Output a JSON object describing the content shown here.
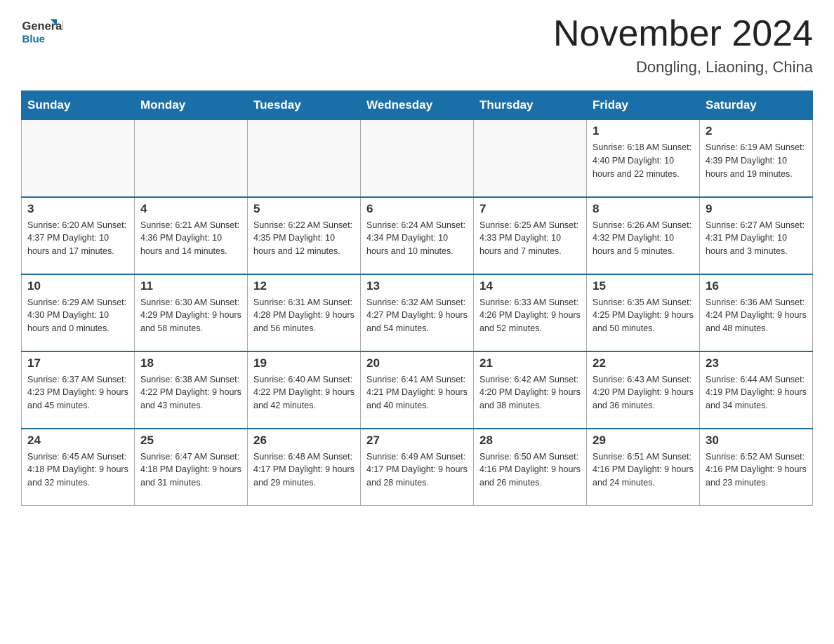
{
  "header": {
    "logo_general": "General",
    "logo_blue": "Blue",
    "month_title": "November 2024",
    "location": "Dongling, Liaoning, China"
  },
  "days_of_week": [
    "Sunday",
    "Monday",
    "Tuesday",
    "Wednesday",
    "Thursday",
    "Friday",
    "Saturday"
  ],
  "weeks": [
    {
      "days": [
        {
          "number": "",
          "info": ""
        },
        {
          "number": "",
          "info": ""
        },
        {
          "number": "",
          "info": ""
        },
        {
          "number": "",
          "info": ""
        },
        {
          "number": "",
          "info": ""
        },
        {
          "number": "1",
          "info": "Sunrise: 6:18 AM\nSunset: 4:40 PM\nDaylight: 10 hours\nand 22 minutes."
        },
        {
          "number": "2",
          "info": "Sunrise: 6:19 AM\nSunset: 4:39 PM\nDaylight: 10 hours\nand 19 minutes."
        }
      ]
    },
    {
      "days": [
        {
          "number": "3",
          "info": "Sunrise: 6:20 AM\nSunset: 4:37 PM\nDaylight: 10 hours\nand 17 minutes."
        },
        {
          "number": "4",
          "info": "Sunrise: 6:21 AM\nSunset: 4:36 PM\nDaylight: 10 hours\nand 14 minutes."
        },
        {
          "number": "5",
          "info": "Sunrise: 6:22 AM\nSunset: 4:35 PM\nDaylight: 10 hours\nand 12 minutes."
        },
        {
          "number": "6",
          "info": "Sunrise: 6:24 AM\nSunset: 4:34 PM\nDaylight: 10 hours\nand 10 minutes."
        },
        {
          "number": "7",
          "info": "Sunrise: 6:25 AM\nSunset: 4:33 PM\nDaylight: 10 hours\nand 7 minutes."
        },
        {
          "number": "8",
          "info": "Sunrise: 6:26 AM\nSunset: 4:32 PM\nDaylight: 10 hours\nand 5 minutes."
        },
        {
          "number": "9",
          "info": "Sunrise: 6:27 AM\nSunset: 4:31 PM\nDaylight: 10 hours\nand 3 minutes."
        }
      ]
    },
    {
      "days": [
        {
          "number": "10",
          "info": "Sunrise: 6:29 AM\nSunset: 4:30 PM\nDaylight: 10 hours\nand 0 minutes."
        },
        {
          "number": "11",
          "info": "Sunrise: 6:30 AM\nSunset: 4:29 PM\nDaylight: 9 hours\nand 58 minutes."
        },
        {
          "number": "12",
          "info": "Sunrise: 6:31 AM\nSunset: 4:28 PM\nDaylight: 9 hours\nand 56 minutes."
        },
        {
          "number": "13",
          "info": "Sunrise: 6:32 AM\nSunset: 4:27 PM\nDaylight: 9 hours\nand 54 minutes."
        },
        {
          "number": "14",
          "info": "Sunrise: 6:33 AM\nSunset: 4:26 PM\nDaylight: 9 hours\nand 52 minutes."
        },
        {
          "number": "15",
          "info": "Sunrise: 6:35 AM\nSunset: 4:25 PM\nDaylight: 9 hours\nand 50 minutes."
        },
        {
          "number": "16",
          "info": "Sunrise: 6:36 AM\nSunset: 4:24 PM\nDaylight: 9 hours\nand 48 minutes."
        }
      ]
    },
    {
      "days": [
        {
          "number": "17",
          "info": "Sunrise: 6:37 AM\nSunset: 4:23 PM\nDaylight: 9 hours\nand 45 minutes."
        },
        {
          "number": "18",
          "info": "Sunrise: 6:38 AM\nSunset: 4:22 PM\nDaylight: 9 hours\nand 43 minutes."
        },
        {
          "number": "19",
          "info": "Sunrise: 6:40 AM\nSunset: 4:22 PM\nDaylight: 9 hours\nand 42 minutes."
        },
        {
          "number": "20",
          "info": "Sunrise: 6:41 AM\nSunset: 4:21 PM\nDaylight: 9 hours\nand 40 minutes."
        },
        {
          "number": "21",
          "info": "Sunrise: 6:42 AM\nSunset: 4:20 PM\nDaylight: 9 hours\nand 38 minutes."
        },
        {
          "number": "22",
          "info": "Sunrise: 6:43 AM\nSunset: 4:20 PM\nDaylight: 9 hours\nand 36 minutes."
        },
        {
          "number": "23",
          "info": "Sunrise: 6:44 AM\nSunset: 4:19 PM\nDaylight: 9 hours\nand 34 minutes."
        }
      ]
    },
    {
      "days": [
        {
          "number": "24",
          "info": "Sunrise: 6:45 AM\nSunset: 4:18 PM\nDaylight: 9 hours\nand 32 minutes."
        },
        {
          "number": "25",
          "info": "Sunrise: 6:47 AM\nSunset: 4:18 PM\nDaylight: 9 hours\nand 31 minutes."
        },
        {
          "number": "26",
          "info": "Sunrise: 6:48 AM\nSunset: 4:17 PM\nDaylight: 9 hours\nand 29 minutes."
        },
        {
          "number": "27",
          "info": "Sunrise: 6:49 AM\nSunset: 4:17 PM\nDaylight: 9 hours\nand 28 minutes."
        },
        {
          "number": "28",
          "info": "Sunrise: 6:50 AM\nSunset: 4:16 PM\nDaylight: 9 hours\nand 26 minutes."
        },
        {
          "number": "29",
          "info": "Sunrise: 6:51 AM\nSunset: 4:16 PM\nDaylight: 9 hours\nand 24 minutes."
        },
        {
          "number": "30",
          "info": "Sunrise: 6:52 AM\nSunset: 4:16 PM\nDaylight: 9 hours\nand 23 minutes."
        }
      ]
    }
  ]
}
